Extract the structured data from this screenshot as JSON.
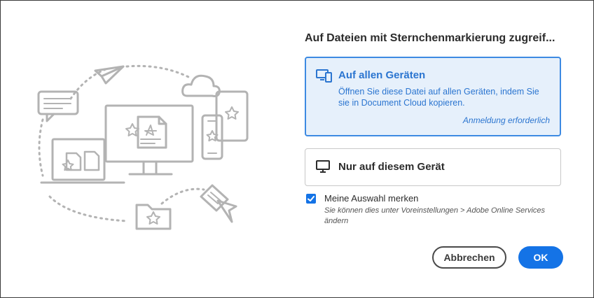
{
  "dialog": {
    "title": "Auf Dateien mit Sternchenmarkierung zugreif...",
    "options": [
      {
        "title": "Auf allen Geräten",
        "description": "Öffnen Sie diese Datei auf allen Geräten, indem Sie sie in Document Cloud kopieren.",
        "note": "Anmeldung erforderlich",
        "icon": "devices-icon",
        "selected": true
      },
      {
        "title": "Nur auf diesem Gerät",
        "icon": "monitor-icon",
        "selected": false
      }
    ],
    "remember": {
      "label": "Meine Auswahl merken",
      "hint": "Sie können dies unter Voreinstellungen > Adobe Online Services ändern",
      "checked": true
    },
    "buttons": {
      "cancel": "Abbrechen",
      "ok": "OK"
    }
  },
  "colors": {
    "accent": "#1473e6",
    "selected_bg": "#e6f0fb",
    "selected_border": "#3d8ae2",
    "illustration_stroke": "#b3b3b3"
  }
}
